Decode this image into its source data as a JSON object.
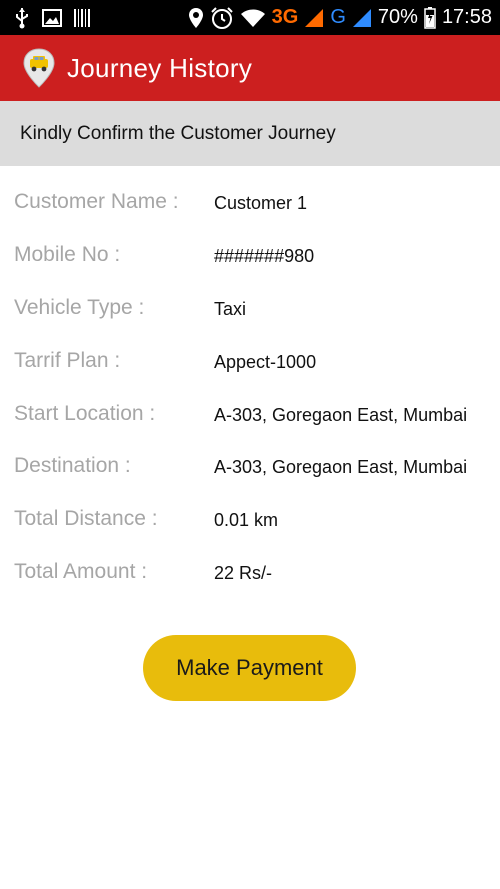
{
  "status_bar": {
    "network_3g": "3G",
    "network_g": "G",
    "battery": "70%",
    "time": "17:58",
    "icons": [
      "usb-icon",
      "image-icon",
      "barcode-icon",
      "location-icon",
      "alarm-icon",
      "wifi-icon",
      "signal-icon",
      "battery-icon"
    ]
  },
  "app_bar": {
    "title": "Journey History",
    "brand_color": "#cc1f1f",
    "logo_icon": "taxi-location-pin-icon"
  },
  "banner": {
    "text": "Kindly Confirm the Customer Journey"
  },
  "details": [
    {
      "label": "Customer Name :",
      "value": "Customer 1"
    },
    {
      "label": "Mobile No :",
      "value": "#######980"
    },
    {
      "label": "Vehicle Type :",
      "value": "Taxi"
    },
    {
      "label": "Tarrif Plan :",
      "value": "Appect-1000"
    },
    {
      "label": "Start Location :",
      "value": "A-303, Goregaon East, Mumbai"
    },
    {
      "label": "Destination :",
      "value": "A-303, Goregaon East, Mumbai"
    },
    {
      "label": "Total Distance :",
      "value": "0.01 km"
    },
    {
      "label": "Total Amount :",
      "value": "22 Rs/-"
    }
  ],
  "actions": {
    "pay_label": "Make Payment",
    "pay_color": "#e8bc0c"
  }
}
